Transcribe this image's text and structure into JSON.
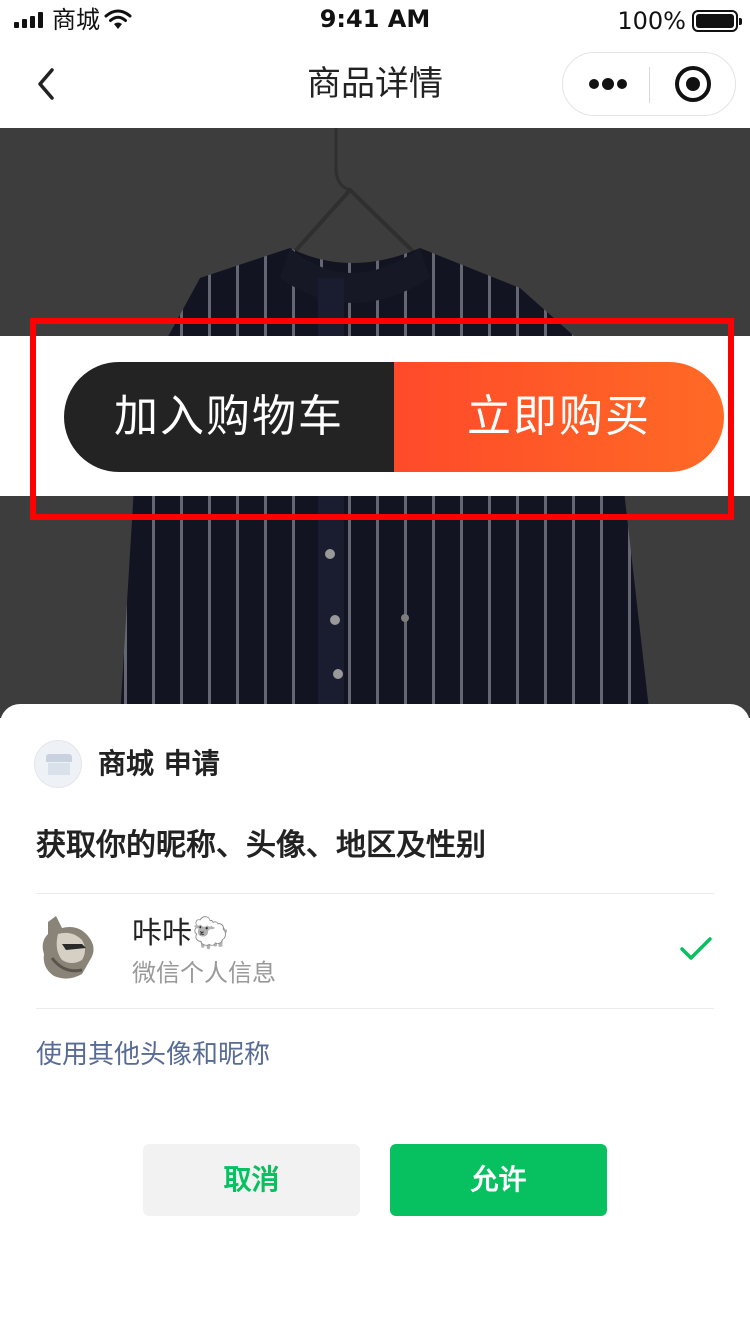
{
  "status_bar": {
    "carrier": "商城",
    "time": "9:41 AM",
    "battery": "100%"
  },
  "nav": {
    "title": "商品详情",
    "back_icon": "chevron-left-icon",
    "more_icon": "more-dots-icon",
    "close_icon": "target-icon"
  },
  "actions": {
    "add_to_cart": "加入购物车",
    "buy_now": "立即购买"
  },
  "colors": {
    "accent_orange": "#ff4a2a",
    "dark_button": "#232323",
    "wechat_green": "#07c160",
    "link_blue": "#576b95",
    "highlight_red": "#ff0000"
  },
  "sheet": {
    "app_name": "商城 申请",
    "title": "获取你的昵称、头像、地区及性别",
    "user": {
      "nickname": "咔咔🐑",
      "subtitle": "微信个人信息"
    },
    "other_link": "使用其他头像和昵称",
    "cancel": "取消",
    "allow": "允许"
  }
}
